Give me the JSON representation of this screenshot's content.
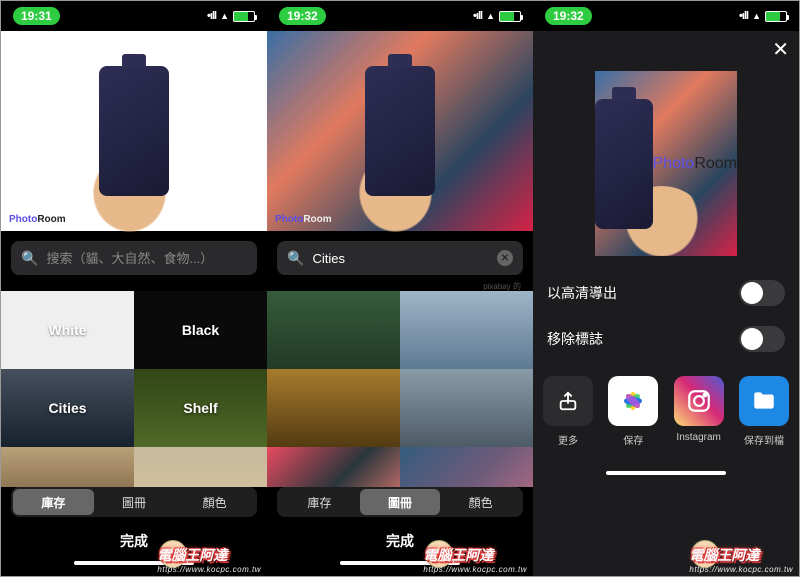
{
  "status": {
    "time_a": "19:31",
    "time_b": "19:32",
    "time_c": "19:32"
  },
  "watermark": {
    "brand1": "Photo",
    "brand2": "Room"
  },
  "search": {
    "placeholder": "搜索（貓、大自然、食物...）",
    "value_b": "Cities",
    "attr": "pixabay 的"
  },
  "tiles": {
    "white": "White",
    "black": "Black",
    "cities": "Cities",
    "shelf": "Shelf"
  },
  "seg": {
    "storage": "庫存",
    "album": "圖冊",
    "color": "顏色"
  },
  "done": "完成",
  "export": {
    "hd": "以高清導出",
    "remove_logo": "移除標誌"
  },
  "actions": {
    "more": "更多",
    "save": "保存",
    "instagram": "Instagram",
    "save_to": "保存到檔"
  },
  "site_watermark": {
    "title": "電腦王阿達",
    "url": "https://www.kocpc.com.tw"
  }
}
